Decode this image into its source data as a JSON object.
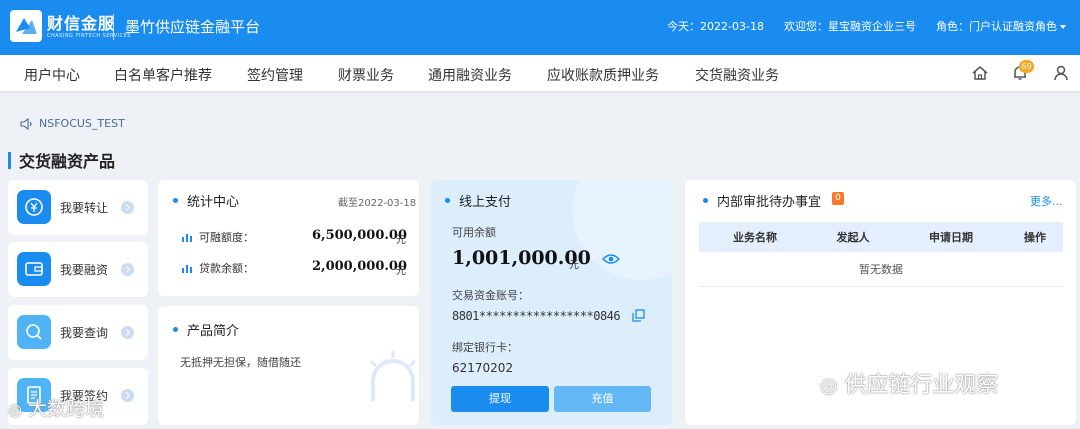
{
  "header": {
    "brand_name": "财信金服",
    "brand_sub": "CHASING FINTECH SERVICES",
    "platform_title": "墨竹供应链金融平台",
    "date_text": "今天：2022-03-18",
    "welcome_text": "欢迎您：星宝融资企业三号",
    "role_text": "角色：门户认证融资角色"
  },
  "nav": {
    "items": [
      "用户中心",
      "白名单客户推荐",
      "签约管理",
      "财票业务",
      "通用融资业务",
      "应收账款质押业务",
      "交货融资业务"
    ],
    "notification_count": "69",
    "icons": [
      "home-icon",
      "bell-icon",
      "user-icon"
    ]
  },
  "notice": {
    "text": "NSFOCUS_TEST"
  },
  "section": {
    "title": "交货融资产品"
  },
  "quick_actions": [
    {
      "label": "我要转让",
      "icon": "transfer-icon"
    },
    {
      "label": "我要融资",
      "icon": "wallet-icon"
    },
    {
      "label": "我要查询",
      "icon": "search-icon"
    },
    {
      "label": "我要签约",
      "icon": "contract-icon"
    }
  ],
  "stats": {
    "title": "统计中心",
    "as_of": "截至2022-03-18",
    "rows": [
      {
        "label": "可融额度：",
        "value": "6,500,000.00",
        "unit": "元"
      },
      {
        "label": "贷款余额：",
        "value": "2,000,000.00",
        "unit": "元"
      }
    ]
  },
  "product": {
    "title": "产品简介",
    "desc": "无抵押无担保，随借随还"
  },
  "payment": {
    "title": "线上支付",
    "balance_label": "可用余额",
    "balance": "1,001,000.00",
    "balance_unit": "元",
    "account_label": "交易资金账号：",
    "account": "8801*****************0846",
    "bank_label": "绑定银行卡：",
    "bank_card": "62170202",
    "withdraw_label": "提现",
    "recharge_label": "充值"
  },
  "todo": {
    "title": "内部审批待办事宜",
    "count": "0",
    "more_label": "更多...",
    "columns": [
      "业务名称",
      "发起人",
      "申请日期",
      "操作"
    ],
    "empty_text": "暂无数据"
  },
  "watermarks": {
    "left": "大数跨境",
    "right": "供应链行业观察"
  },
  "colors": {
    "primary": "#1a8cf0",
    "badge": "#f5a623",
    "pay_bg": "#dcedfc"
  }
}
